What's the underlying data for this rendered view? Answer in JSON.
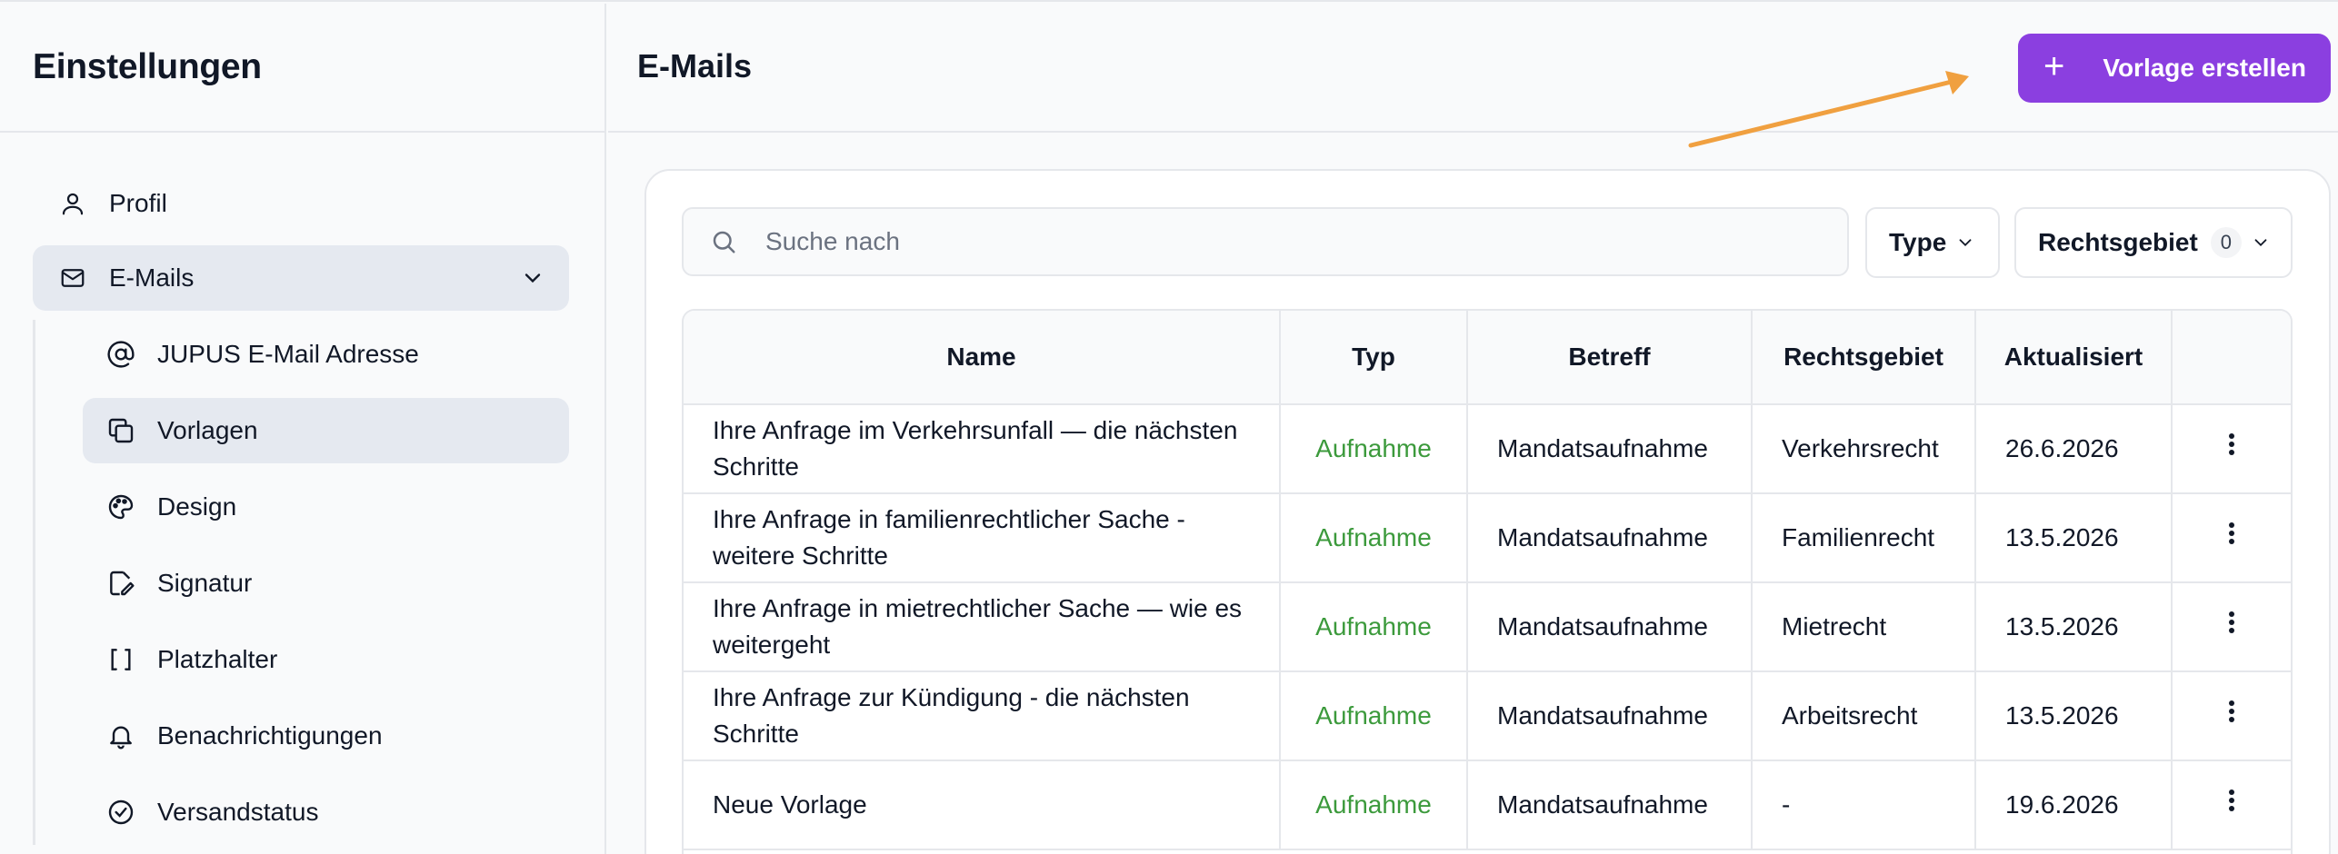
{
  "sidebar": {
    "title": "Einstellungen",
    "items": [
      {
        "label": "Profil",
        "icon": "user-icon"
      },
      {
        "label": "E-Mails",
        "icon": "mail-icon"
      }
    ],
    "sub_items": [
      {
        "label": "JUPUS E-Mail Adresse",
        "icon": "at-icon"
      },
      {
        "label": "Vorlagen",
        "icon": "copy-icon"
      },
      {
        "label": "Design",
        "icon": "palette-icon"
      },
      {
        "label": "Signatur",
        "icon": "signature-icon"
      },
      {
        "label": "Platzhalter",
        "icon": "brackets-icon"
      },
      {
        "label": "Benachrichtigungen",
        "icon": "bell-icon"
      },
      {
        "label": "Versandstatus",
        "icon": "check-circle-icon"
      }
    ]
  },
  "header": {
    "title": "E-Mails",
    "create_button": {
      "icon": "+",
      "label": "Vorlage erstellen"
    }
  },
  "toolbar": {
    "search_placeholder": "Suche nach",
    "filter_type": "Type",
    "filter_rechtsgebiet": "Rechtsgebiet",
    "rechtsgebiet_count": "0"
  },
  "table": {
    "columns": [
      "Name",
      "Typ",
      "Betreff",
      "Rechtsgebiet",
      "Aktualisiert"
    ],
    "rows": [
      {
        "name": "Ihre Anfrage im Verkehrsunfall — die nächsten Schritte",
        "typ": "Aufnahme",
        "betreff": "Mandatsaufnahme",
        "rechtsgebiet": "Verkehrsrecht",
        "aktualisiert": "26.6.2026"
      },
      {
        "name": "Ihre Anfrage in familienrechtlicher Sache - weitere Schritte",
        "typ": "Aufnahme",
        "betreff": "Mandatsaufnahme",
        "rechtsgebiet": "Familienrecht",
        "aktualisiert": "13.5.2026"
      },
      {
        "name": "Ihre Anfrage in mietrechtlicher Sache — wie es weitergeht",
        "typ": "Aufnahme",
        "betreff": "Mandatsaufnahme",
        "rechtsgebiet": "Mietrecht",
        "aktualisiert": "13.5.2026"
      },
      {
        "name": "Ihre Anfrage zur Kündigung - die nächsten Schritte",
        "typ": "Aufnahme",
        "betreff": "Mandatsaufnahme",
        "rechtsgebiet": "Arbeitsrecht",
        "aktualisiert": "13.5.2026"
      },
      {
        "name": "Neue Vorlage",
        "typ": "Aufnahme",
        "betreff": "Mandatsaufnahme",
        "rechtsgebiet": "-",
        "aktualisiert": "19.6.2026"
      }
    ]
  },
  "colors": {
    "accent": "#8b3fe0",
    "typ_green": "#3c9a3c",
    "arrow": "#f0a040",
    "active_bg": "#e5e9f0"
  }
}
